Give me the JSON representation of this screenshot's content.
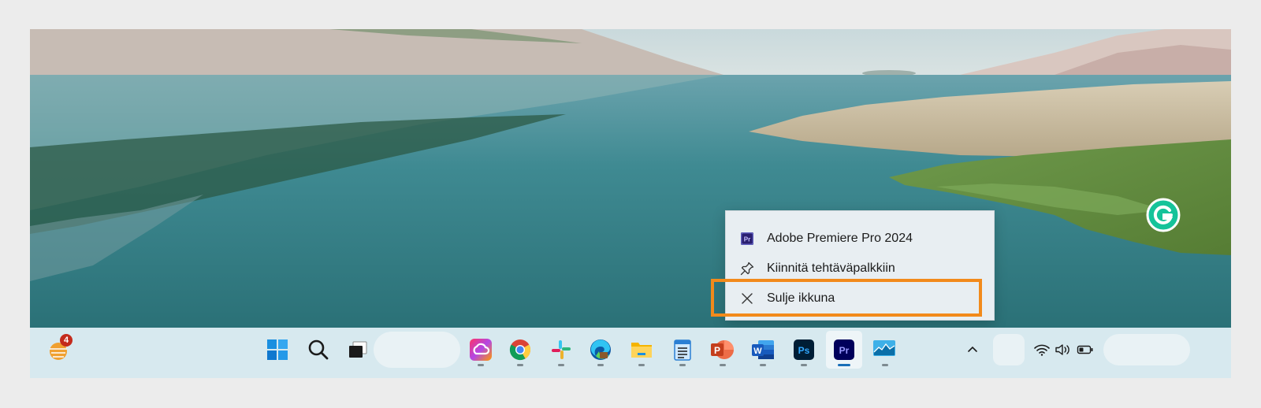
{
  "context_menu": {
    "app_name": "Adobe Premiere Pro 2024",
    "pin_label": "Kiinnitä tehtäväpalkkiin",
    "close_label": "Sulje ikkuna",
    "highlight_color": "#f28a1b"
  },
  "taskbar": {
    "widgets_badge": "4",
    "pinned_apps": [
      "windows-start-icon",
      "search-icon",
      "task-view-icon",
      "creative-cloud-icon",
      "chrome-icon",
      "slack-icon",
      "edge-icon",
      "file-explorer-icon",
      "notepad-icon",
      "powerpoint-icon",
      "word-icon",
      "photoshop-icon",
      "premiere-pro-icon",
      "monitor-app-icon"
    ],
    "ps_label": "Ps",
    "pr_label": "Pr",
    "word_label": "W",
    "ppt_label": "P"
  },
  "grammarly_label": "G",
  "colors": {
    "taskbar": "#d7e9ef",
    "menu_bg": "#e8eef2",
    "premiere": "#2a1f70",
    "photoshop": "#0f2b45"
  }
}
